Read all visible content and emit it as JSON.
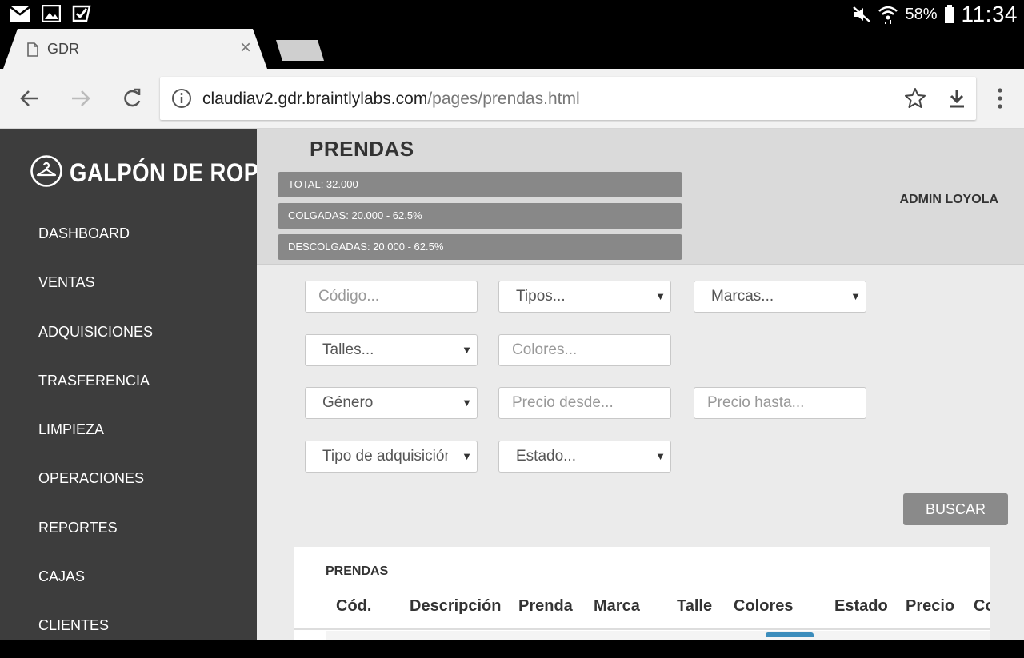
{
  "status_bar": {
    "battery": "58%",
    "time": "11:34"
  },
  "browser": {
    "tab_title": "GDR",
    "url_domain": "claudiav2.gdr.braintlylabs.com",
    "url_path": "/pages/prendas.html"
  },
  "sidebar": {
    "logo_text": "GALPÓN DE ROPA",
    "items": [
      {
        "label": "DASHBOARD"
      },
      {
        "label": "VENTAS"
      },
      {
        "label": "ADQUISICIONES"
      },
      {
        "label": "TRASFERENCIA"
      },
      {
        "label": "LIMPIEZA"
      },
      {
        "label": "OPERACIONES"
      },
      {
        "label": "REPORTES"
      },
      {
        "label": "CAJAS"
      },
      {
        "label": "CLIENTES"
      }
    ]
  },
  "header": {
    "title": "PRENDAS",
    "stats": {
      "total": "TOTAL: 32.000",
      "colgadas": "COLGADAS: 20.000 - 62.5%",
      "descolgadas": "DESCOLGADAS: 20.000 - 62.5%"
    },
    "user": "ADMIN LOYOLA"
  },
  "filters": {
    "codigo_placeholder": "Código...",
    "tipos": "Tipos...",
    "marcas": "Marcas...",
    "talles": "Talles...",
    "colores_placeholder": "Colores...",
    "genero": "Género",
    "precio_desde_placeholder": "Precio desde...",
    "precio_hasta_placeholder": "Precio hasta...",
    "tipo_adquisicion": "Tipo de adquisición",
    "estado": "Estado...",
    "buscar": "BUSCAR"
  },
  "table": {
    "title": "PRENDAS",
    "columns": [
      "Cód.",
      "Descripción",
      "Prenda",
      "Marca",
      "Talle",
      "Colores",
      "Estado",
      "Precio",
      "Co"
    ]
  },
  "colors": {
    "sidebar_bg": "#3d3d3d",
    "header_bg": "#dadada",
    "stat_bar": "#888888",
    "button": "#8a8a8a",
    "accent": "#3c8dbc"
  }
}
